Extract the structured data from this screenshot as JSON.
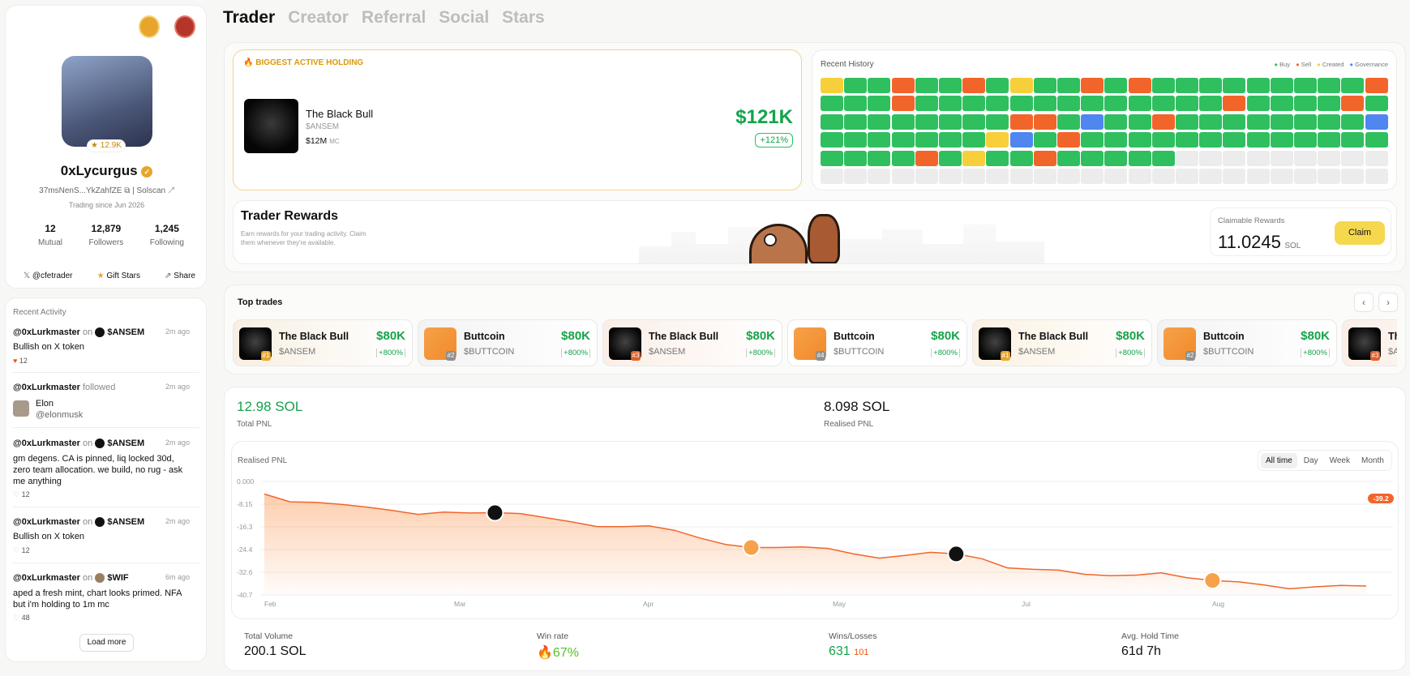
{
  "profile": {
    "rating": "12.9K",
    "name": "0xLycurgus",
    "address": "37msNenS...YkZahfZE",
    "solscan": "Solscan",
    "since": "Trading since Jun 2026",
    "stats": [
      {
        "value": "12",
        "label": "Mutual"
      },
      {
        "value": "12,879",
        "label": "Followers"
      },
      {
        "value": "1,245",
        "label": "Following"
      }
    ],
    "twitter": "@cfetrader",
    "gift": "Gift Stars",
    "share": "Share"
  },
  "activity": {
    "title": "Recent Activity",
    "load_more": "Load more",
    "items": [
      {
        "user": "@0xLurkmaster",
        "verb": "on",
        "token": "$ANSEM",
        "time": "2m ago",
        "text": "Bullish on X token",
        "likes": "12"
      },
      {
        "user": "@0xLurkmaster",
        "verb": "followed",
        "time": "2m ago",
        "follow_name": "Elon",
        "follow_handle": "@elonmusk"
      },
      {
        "user": "@0xLurkmaster",
        "verb": "on",
        "token": "$ANSEM",
        "time": "2m ago",
        "text": "gm degens. CA is pinned, liq locked 30d, zero team allocation. we build, no rug - ask me anything",
        "likes": "12"
      },
      {
        "user": "@0xLurkmaster",
        "verb": "on",
        "token": "$ANSEM",
        "time": "2m ago",
        "text": "Bullish on X token",
        "likes": "12"
      },
      {
        "user": "@0xLurkmaster",
        "verb": "on",
        "token": "$WIF",
        "time": "6m ago",
        "text": "aped a fresh mint, chart looks primed. NFA but i'm holding to 1m mc",
        "likes": "48"
      }
    ]
  },
  "tabs": [
    "Trader",
    "Creator",
    "Referral",
    "Social",
    "Stars"
  ],
  "holding": {
    "label": "BIGGEST ACTIVE HOLDING",
    "name": "The Black Bull",
    "ticker": "$ANSEM",
    "mc": "$12M",
    "mc_label": "MC",
    "value": "$121K",
    "change": "+121%"
  },
  "history": {
    "title": "Recent History",
    "legend": [
      "Buy",
      "Sell",
      "Created",
      "Governance"
    ],
    "colors": {
      "b": "#2fbf5f",
      "s": "#f2652a",
      "c": "#f7cf3a",
      "g": "#4f86f0",
      "e": "#ececec"
    },
    "rows": [
      "cbbsbbsbcbbsbsbbbbbbbbbs",
      "bbbsbbbbbbbbbbbbbsbbbbsb",
      "bbbbbbbbssbgbbsbbbbbbbbg",
      "bbbbbbbcgbsbbbbbbbbbbbbb",
      "bbbbsbcbbsbbbbbeeeeeeeee",
      "eeeeeeeeeeeeeeeeeeeeeeee"
    ]
  },
  "rewards": {
    "title": "Trader Rewards",
    "desc": "Earn rewards for your trading activity. Claim them whenever they're available.",
    "claimable_label": "Claimable Rewards",
    "amount": "11.0245",
    "unit": "SOL",
    "claim": "Claim"
  },
  "top_trades": {
    "title": "Top trades",
    "items": [
      {
        "name": "The Black Bull",
        "ticker": "$ANSEM",
        "price": "$80K",
        "change": "+800%",
        "rank": "#1"
      },
      {
        "name": "Buttcoin",
        "ticker": "$BUTTCOIN",
        "price": "$80K",
        "change": "+800%",
        "rank": "#2"
      },
      {
        "name": "The Black Bull",
        "ticker": "$ANSEM",
        "price": "$80K",
        "change": "+800%",
        "rank": "#3"
      },
      {
        "name": "Buttcoin",
        "ticker": "$BUTTCOIN",
        "price": "$80K",
        "change": "+800%",
        "rank": "#4"
      },
      {
        "name": "The Black Bull",
        "ticker": "$ANSEM",
        "price": "$80K",
        "change": "+800%",
        "rank": "#1"
      },
      {
        "name": "Buttcoin",
        "ticker": "$BUTTCOIN",
        "price": "$80K",
        "change": "+800%",
        "rank": "#2"
      },
      {
        "name": "Th",
        "ticker": "$A",
        "price": "",
        "change": "",
        "rank": "#3"
      }
    ]
  },
  "pnl": {
    "total": "12.98 SOL",
    "total_label": "Total PNL",
    "realised": "8.098 SOL",
    "realised_label": "Realised PNL"
  },
  "chart_data": {
    "type": "area",
    "title": "Realised PNL",
    "ranges": [
      "All time",
      "Day",
      "Week",
      "Month"
    ],
    "selected_range": "All time",
    "yticks": [
      "0.000",
      "-8.15",
      "-16.3",
      "-24.4",
      "-32.6",
      "-40.7"
    ],
    "ylim": [
      -40.7,
      0
    ],
    "xticks": [
      "Feb",
      "Mar",
      "Apr",
      "May",
      "Jul",
      "Aug"
    ],
    "last_value_label": "-39.2",
    "values": [
      -4.5,
      -7.3,
      -7.5,
      -8.2,
      -9.2,
      -10.4,
      -11.8,
      -11.0,
      -11.3,
      -11.2,
      -11.5,
      -13.0,
      -14.5,
      -16.2,
      -16.2,
      -15.9,
      -17.5,
      -20.3,
      -22.6,
      -23.7,
      -23.7,
      -23.5,
      -24.0,
      -26.0,
      -27.5,
      -26.5,
      -25.4,
      -26.0,
      -27.7,
      -31.0,
      -31.5,
      -31.8,
      -33.3,
      -33.8,
      -33.6,
      -32.8,
      -34.5,
      -35.5,
      -36.0,
      -37.1,
      -38.5,
      -37.8,
      -37.3,
      -37.5
    ]
  },
  "stats": [
    {
      "label": "Total Volume",
      "value": "200.1 SOL"
    },
    {
      "label": "Win rate",
      "value": "67%"
    },
    {
      "label": "Wins/Losses",
      "value": "631",
      "value2": "101"
    },
    {
      "label": "Avg. Hold Time",
      "value": "61d 7h"
    }
  ]
}
